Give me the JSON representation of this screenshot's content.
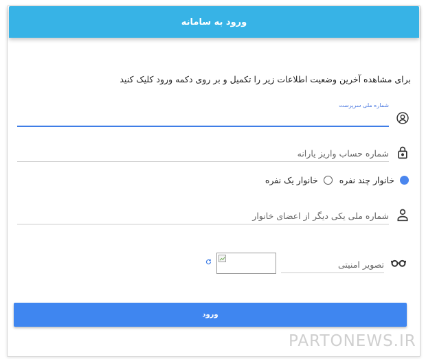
{
  "header": {
    "title": "ورود به سامانه"
  },
  "intro_text": "برای مشاهده آخرین وضعیت اطلاعات زیر را تکمیل و بر روی دکمه ورود کلیک کنید",
  "form": {
    "guardian_national_id": {
      "label": "شماره ملی سرپرست",
      "value": ""
    },
    "subsidy_account": {
      "placeholder": "شماره حساب واریز یارانه",
      "value": ""
    },
    "household_type": {
      "options": [
        "خانوار چند نفره",
        "خانوار یک نفره"
      ],
      "selected": "خانوار چند نفره"
    },
    "other_member_id": {
      "placeholder": "شماره ملی یکی دیگر از اعضای خانوار",
      "value": ""
    },
    "captcha": {
      "placeholder": "تصویر امنیتی",
      "value": ""
    },
    "submit_label": "ورود"
  },
  "icons": {
    "guardian": "account-circle-icon",
    "account": "lock-icon",
    "member": "person-icon",
    "captcha": "glasses-icon",
    "refresh": "refresh-icon",
    "captcha_image": "broken-image-icon"
  },
  "colors": {
    "header": "#37b3e6",
    "button": "#3f86f0",
    "accent": "#4a78e0"
  },
  "watermark": "PARTONEWS.IR"
}
